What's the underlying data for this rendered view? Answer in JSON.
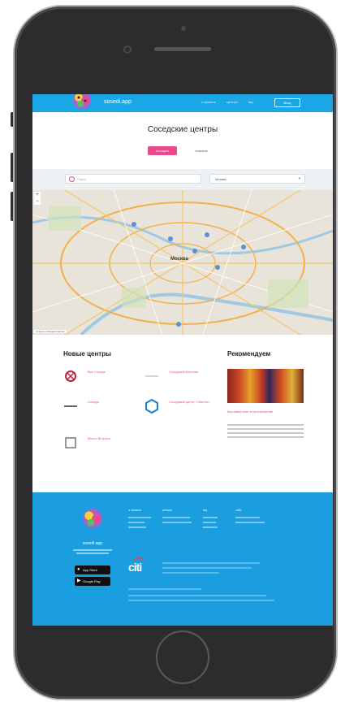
{
  "brand": "sosedi.app",
  "nav": {
    "links": [
      "о проекте",
      "центры",
      "faq"
    ],
    "button": "Вход"
  },
  "page_title": "Соседские центры",
  "tabs": [
    "на карте",
    "списком"
  ],
  "search_placeholder": "Поиск",
  "city_select": "Москва",
  "map": {
    "city_label": "Москва",
    "attribution": "Открыть в Яндекс.Картах"
  },
  "new_centers": {
    "title": "Новые центры",
    "items": [
      {
        "name": "Все Соседи"
      },
      {
        "name": "Соседский Вестник"
      },
      {
        "name": "Соседи"
      },
      {
        "name": "Соседский центр «Эпилог»"
      },
      {
        "name": "Место Встречи"
      }
    ]
  },
  "recommend": {
    "title": "Рекомендуем",
    "item_title": "Выставка книг в пространстве"
  },
  "footer": {
    "brand": "sosedi.app",
    "stores": [
      "App Store",
      "Google Play"
    ],
    "partner": "citi",
    "columns": [
      "о проекте",
      "центры",
      "faq",
      "сайт"
    ]
  },
  "colors": {
    "nav": "#1ba7e6",
    "accent": "#e84a8c",
    "footer": "#1a9ee0",
    "phone": "#2c2c2e"
  }
}
